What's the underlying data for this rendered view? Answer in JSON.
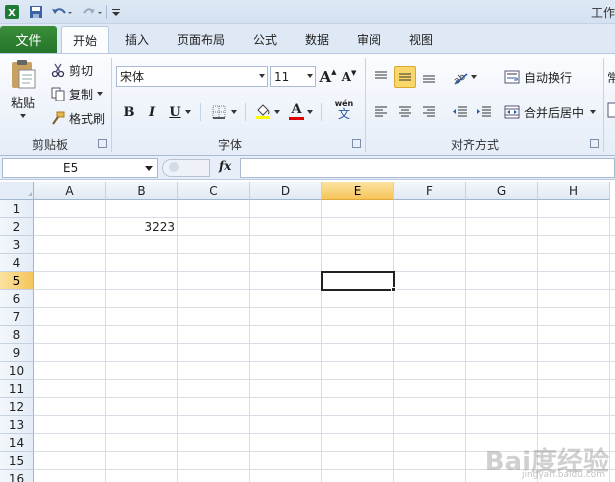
{
  "window": {
    "title": "工作"
  },
  "quick_access": {
    "icons": [
      "excel-logo-icon",
      "save-icon",
      "undo-icon",
      "redo-icon",
      "customize-icon"
    ]
  },
  "tabs": {
    "file": "文件",
    "home": "开始",
    "insert": "插入",
    "layout": "页面布局",
    "formulas": "公式",
    "data": "数据",
    "review": "审阅",
    "view": "视图"
  },
  "ribbon": {
    "clipboard": {
      "label": "剪贴板",
      "paste": "粘贴",
      "cut": "剪切",
      "copy": "复制",
      "format_painter": "格式刷"
    },
    "font": {
      "label": "字体",
      "name": "宋体",
      "size": "11",
      "bold": "B",
      "italic": "I",
      "underline": "U",
      "grow": "A",
      "shrink": "A",
      "font_color": "A",
      "phonetic": "wén",
      "phonetic2": "文"
    },
    "alignment": {
      "label": "对齐方式",
      "wrap": "自动换行",
      "merge": "合并后居中"
    },
    "overflow_text": "常"
  },
  "formula_bar": {
    "name_box": "E5",
    "fx": "fx",
    "value": ""
  },
  "sheet": {
    "columns": [
      "A",
      "B",
      "C",
      "D",
      "E",
      "F",
      "G",
      "H"
    ],
    "rows": [
      "1",
      "2",
      "3",
      "4",
      "5",
      "6",
      "7",
      "8",
      "9",
      "10",
      "11",
      "12",
      "13",
      "14",
      "15",
      "16"
    ],
    "selected_column": "E",
    "selected_row": "5",
    "cells": {
      "B2": "3223"
    }
  },
  "watermark": {
    "text": "Bai度经验",
    "sub": "jingyan.baidu.com"
  },
  "colors": {
    "file_tab": "#2a7a2e",
    "selection_header": "#f6c45a",
    "grid_line": "#d9dee6"
  }
}
